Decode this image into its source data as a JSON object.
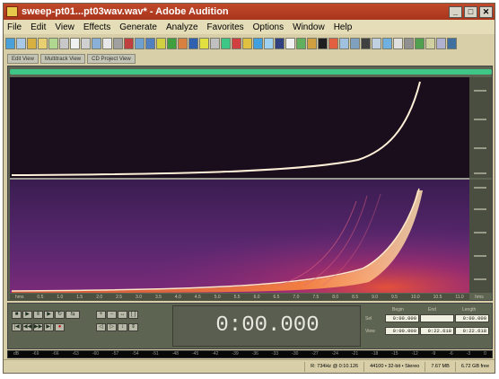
{
  "window": {
    "title": "sweep-pt01...pt03wav.wav* - Adobe Audition"
  },
  "menu": [
    "File",
    "Edit",
    "View",
    "Effects",
    "Generate",
    "Analyze",
    "Favorites",
    "Options",
    "Window",
    "Help"
  ],
  "view_tabs": [
    "Edit View",
    "Multitrack View",
    "CD Project View"
  ],
  "timeline": {
    "ticks": [
      "hms",
      "0.5",
      "1.0",
      "1.5",
      "2.0",
      "2.5",
      "3.0",
      "3.5",
      "4.0",
      "4.5",
      "5.0",
      "5.5",
      "6.0",
      "6.5",
      "7.0",
      "7.5",
      "8.0",
      "8.5",
      "9.0",
      "9.5",
      "10.0",
      "10.5",
      "11.0"
    ],
    "unit": "hms"
  },
  "transport": {
    "time": "0:00.000"
  },
  "selection": {
    "headers": [
      "Begin",
      "End",
      "Length"
    ],
    "rows": [
      {
        "label": "Sel",
        "begin": "0:00.000",
        "end": "",
        "length": "0:00.000"
      },
      {
        "label": "View",
        "begin": "0:00.000",
        "end": "0:22.618",
        "length": "0:22.618"
      }
    ]
  },
  "level_ticks": [
    "dB",
    "-69",
    "-66",
    "-63",
    "-60",
    "-57",
    "-54",
    "-51",
    "-48",
    "-45",
    "-42",
    "-39",
    "-36",
    "-33",
    "-30",
    "-27",
    "-24",
    "-21",
    "-18",
    "-15",
    "-12",
    "-9",
    "-6",
    "-3",
    "0"
  ],
  "status": [
    "R: 734Hz @ 0:10.126",
    "44100 • 32-bit • Stereo",
    "7.67 MB",
    "6.72 GB free"
  ],
  "colors": {
    "title_bar": "#b03c22",
    "overview": "#3ec686",
    "spectrum_bg": "#1a0e1c",
    "sweep": "#fff0d8"
  }
}
